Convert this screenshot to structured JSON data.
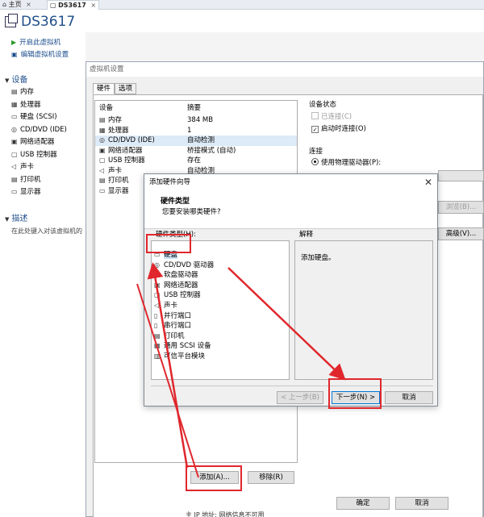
{
  "tabs": [
    {
      "label": "主页",
      "icon": "home-icon"
    },
    {
      "label": "DS3617",
      "icon": "vm-icon"
    }
  ],
  "vm_title": "DS3617",
  "actions": {
    "power_on": "开启此虚拟机",
    "edit_settings": "编辑虚拟机设置"
  },
  "devices_section": {
    "title": "设备",
    "items": [
      {
        "label": "内存",
        "icon": "memory-icon"
      },
      {
        "label": "处理器",
        "icon": "cpu-icon"
      },
      {
        "label": "硬盘 (SCSI)",
        "icon": "hard-disk-icon"
      },
      {
        "label": "CD/DVD (IDE)",
        "icon": "cd-icon"
      },
      {
        "label": "网络适配器",
        "icon": "network-icon"
      },
      {
        "label": "USB 控制器",
        "icon": "usb-icon"
      },
      {
        "label": "声卡",
        "icon": "sound-icon"
      },
      {
        "label": "打印机",
        "icon": "printer-icon"
      },
      {
        "label": "显示器",
        "icon": "display-icon"
      }
    ]
  },
  "description_section": {
    "title": "描述",
    "placeholder": "在此处键入对该虚拟机的"
  },
  "settings_dialog": {
    "title": "虚拟机设置",
    "tabs": [
      "硬件",
      "选项"
    ],
    "hw_headers": {
      "device": "设备",
      "summary": "摘要"
    },
    "hw_rows": [
      {
        "device": "内存",
        "summary": "384 MB",
        "icon": "memory-icon"
      },
      {
        "device": "处理器",
        "summary": "1",
        "icon": "cpu-icon"
      },
      {
        "device": "CD/DVD (IDE)",
        "summary": "自动检测",
        "icon": "cd-icon"
      },
      {
        "device": "网络适配器",
        "summary": "桥接模式 (自动)",
        "icon": "network-icon"
      },
      {
        "device": "USB 控制器",
        "summary": "存在",
        "icon": "usb-icon"
      },
      {
        "device": "声卡",
        "summary": "自动检测",
        "icon": "sound-icon"
      },
      {
        "device": "打印机",
        "summary": "",
        "icon": "printer-icon"
      },
      {
        "device": "显示器",
        "summary": "",
        "icon": "display-icon"
      }
    ],
    "device_status": {
      "title": "设备状态",
      "connected": "已连接(C)",
      "connect_on_power": "启动时连接(O)"
    },
    "connection": {
      "title": "连接",
      "physical_drive": "使用物理驱动器(P):"
    },
    "browse_button": "浏览(B)...",
    "advanced_button": "高级(V)...",
    "add_button": "添加(A)...",
    "remove_button": "移除(R)",
    "ok_button": "确定",
    "cancel_button": "取消",
    "bottom_text": "主 IP 地址: 网络信息不可用"
  },
  "wizard": {
    "title": "添加硬件向导",
    "heading": "硬件类型",
    "subheading": "您要安装哪类硬件?",
    "list_label": "硬件类型(H):",
    "explain_label": "解释",
    "explain_text": "添加硬盘。",
    "items": [
      {
        "label": "硬盘",
        "icon": "hard-disk-icon"
      },
      {
        "label": "CD/DVD 驱动器",
        "icon": "cd-icon"
      },
      {
        "label": "软盘驱动器",
        "icon": "floppy-icon"
      },
      {
        "label": "网络适配器",
        "icon": "network-icon"
      },
      {
        "label": "USB 控制器",
        "icon": "usb-icon"
      },
      {
        "label": "声卡",
        "icon": "sound-icon"
      },
      {
        "label": "并行端口",
        "icon": "parallel-port-icon"
      },
      {
        "label": "串行端口",
        "icon": "serial-port-icon"
      },
      {
        "label": "打印机",
        "icon": "printer-icon"
      },
      {
        "label": "通用 SCSI 设备",
        "icon": "scsi-icon"
      },
      {
        "label": "可信平台模块",
        "icon": "tpm-icon"
      }
    ],
    "back_button": "< 上一步(B)",
    "next_button": "下一步(N) >",
    "cancel_button": "取消"
  },
  "colors": {
    "annotation": "#e0272d",
    "link": "#1a4c8c",
    "selection": "#cce4f7"
  }
}
